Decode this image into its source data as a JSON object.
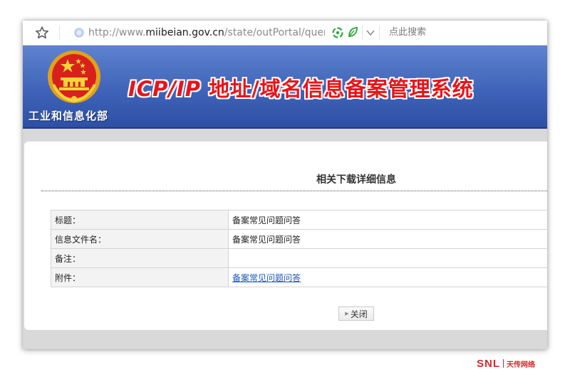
{
  "browser": {
    "url_prefix": "http://www.",
    "url_host": "miibeian.gov.cn",
    "url_path": "/state/outPortal/quer",
    "search_placeholder": "点此搜索"
  },
  "banner": {
    "ministry": "工业和信息化部",
    "title_latin": "ICP/IP",
    "title_cn": " 地址/域名信息备案管理系统"
  },
  "page": {
    "title": "相关下载详细信息",
    "rows": [
      {
        "label": "标题：",
        "value": "备案常见问题问答"
      },
      {
        "label": "信息文件名：",
        "value": "备案常见问题问答"
      },
      {
        "label": "备注：",
        "value": ""
      },
      {
        "label": "附件：",
        "value": "备案常见问题问答"
      }
    ],
    "close_label": "关闭"
  },
  "watermark": {
    "brand": "SNL",
    "cn": "天传网络"
  },
  "colors": {
    "banner_blue": "#3f63b8",
    "title_red": "#e8141a",
    "link_blue": "#1a56b8"
  }
}
